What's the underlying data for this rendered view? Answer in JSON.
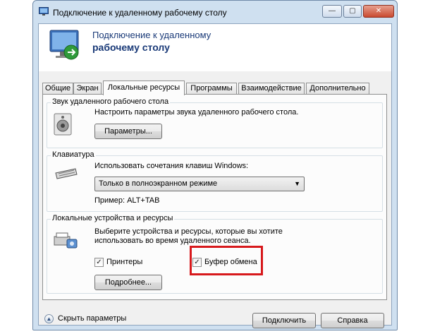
{
  "window": {
    "title": "Подключение к удаленному рабочему столу",
    "minimize_glyph": "—",
    "maximize_glyph": "▢",
    "close_glyph": "✕"
  },
  "header": {
    "line1": "Подключение к удаленному",
    "line2": "рабочему столу"
  },
  "tabs": [
    {
      "label": "Общие",
      "active": false
    },
    {
      "label": "Экран",
      "active": false
    },
    {
      "label": "Локальные ресурсы",
      "active": true
    },
    {
      "label": "Программы",
      "active": false
    },
    {
      "label": "Взаимодействие",
      "active": false
    },
    {
      "label": "Дополнительно",
      "active": false
    }
  ],
  "sound_group": {
    "label": "Звук удаленного рабочего стола",
    "description": "Настроить параметры звука удаленного рабочего стола.",
    "button": "Параметры..."
  },
  "keyboard_group": {
    "label": "Клавиатура",
    "description": "Использовать сочетания клавиш Windows:",
    "selected": "Только в полноэкранном режиме",
    "example": "Пример: ALT+TAB"
  },
  "devices_group": {
    "label": "Локальные устройства и ресурсы",
    "description_line1": "Выберите устройства и ресурсы, которые вы хотите",
    "description_line2": "использовать во время удаленного сеанса.",
    "printers_label": "Принтеры",
    "printers_checked": true,
    "clipboard_label": "Буфер обмена",
    "clipboard_checked": true,
    "more_button": "Подробнее..."
  },
  "footer": {
    "collapse_label": "Скрыть параметры",
    "connect_button": "Подключить",
    "help_button": "Справка"
  },
  "colors": {
    "highlight": "#d7191c",
    "header_text": "#1a3a78"
  },
  "icons": {
    "title": "remote-desktop-icon",
    "header": "remote-desktop-monitor-icon",
    "sound": "speaker-icon",
    "keyboard": "keyboard-icon",
    "devices": "devices-icon",
    "collapse": "chevron-up-icon"
  }
}
